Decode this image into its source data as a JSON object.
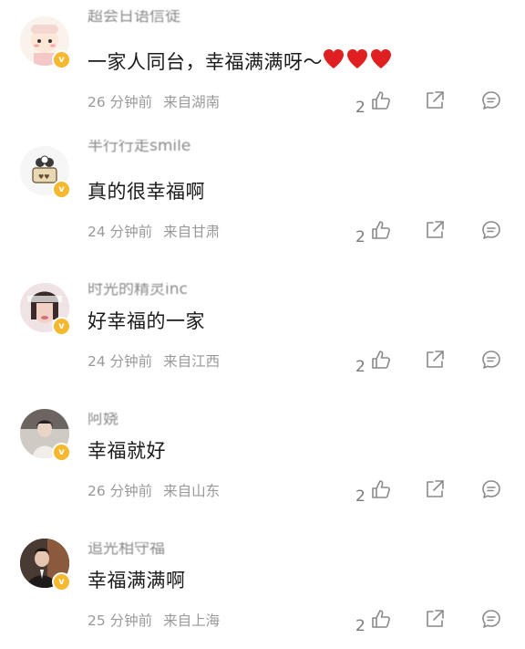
{
  "comments": [
    {
      "username": "超会日语信徒",
      "text": "一家人同台，幸福满满呀～",
      "emoji": "heart-red-x3",
      "time": "26 分钟前",
      "location": "来自湖南",
      "likes": "2",
      "avatar": "cartoon-girl-avatar"
    },
    {
      "username": "半行行走smile",
      "text": "真的很幸福啊",
      "time": "24 分钟前",
      "location": "来自甘肃",
      "likes": "2",
      "avatar": "cartoon-cat-avatar"
    },
    {
      "username": "时光的精灵inc",
      "text": "好幸福的一家",
      "time": "24 分钟前",
      "location": "来自江西",
      "likes": "2",
      "avatar": "photo-girl-avatar"
    },
    {
      "username": "阿娆",
      "text": "幸福就好",
      "time": "26 分钟前",
      "location": "来自山东",
      "likes": "2",
      "avatar": "photo-person-avatar"
    },
    {
      "username": "追光相守福",
      "text": "幸福满满啊",
      "time": "25 分钟前",
      "location": "来自上海",
      "likes": "2",
      "avatar": "photo-man-avatar"
    }
  ],
  "colors": {
    "badge": "#f5b82e",
    "heart": "#e02020",
    "icon": "#8a8a8a"
  }
}
